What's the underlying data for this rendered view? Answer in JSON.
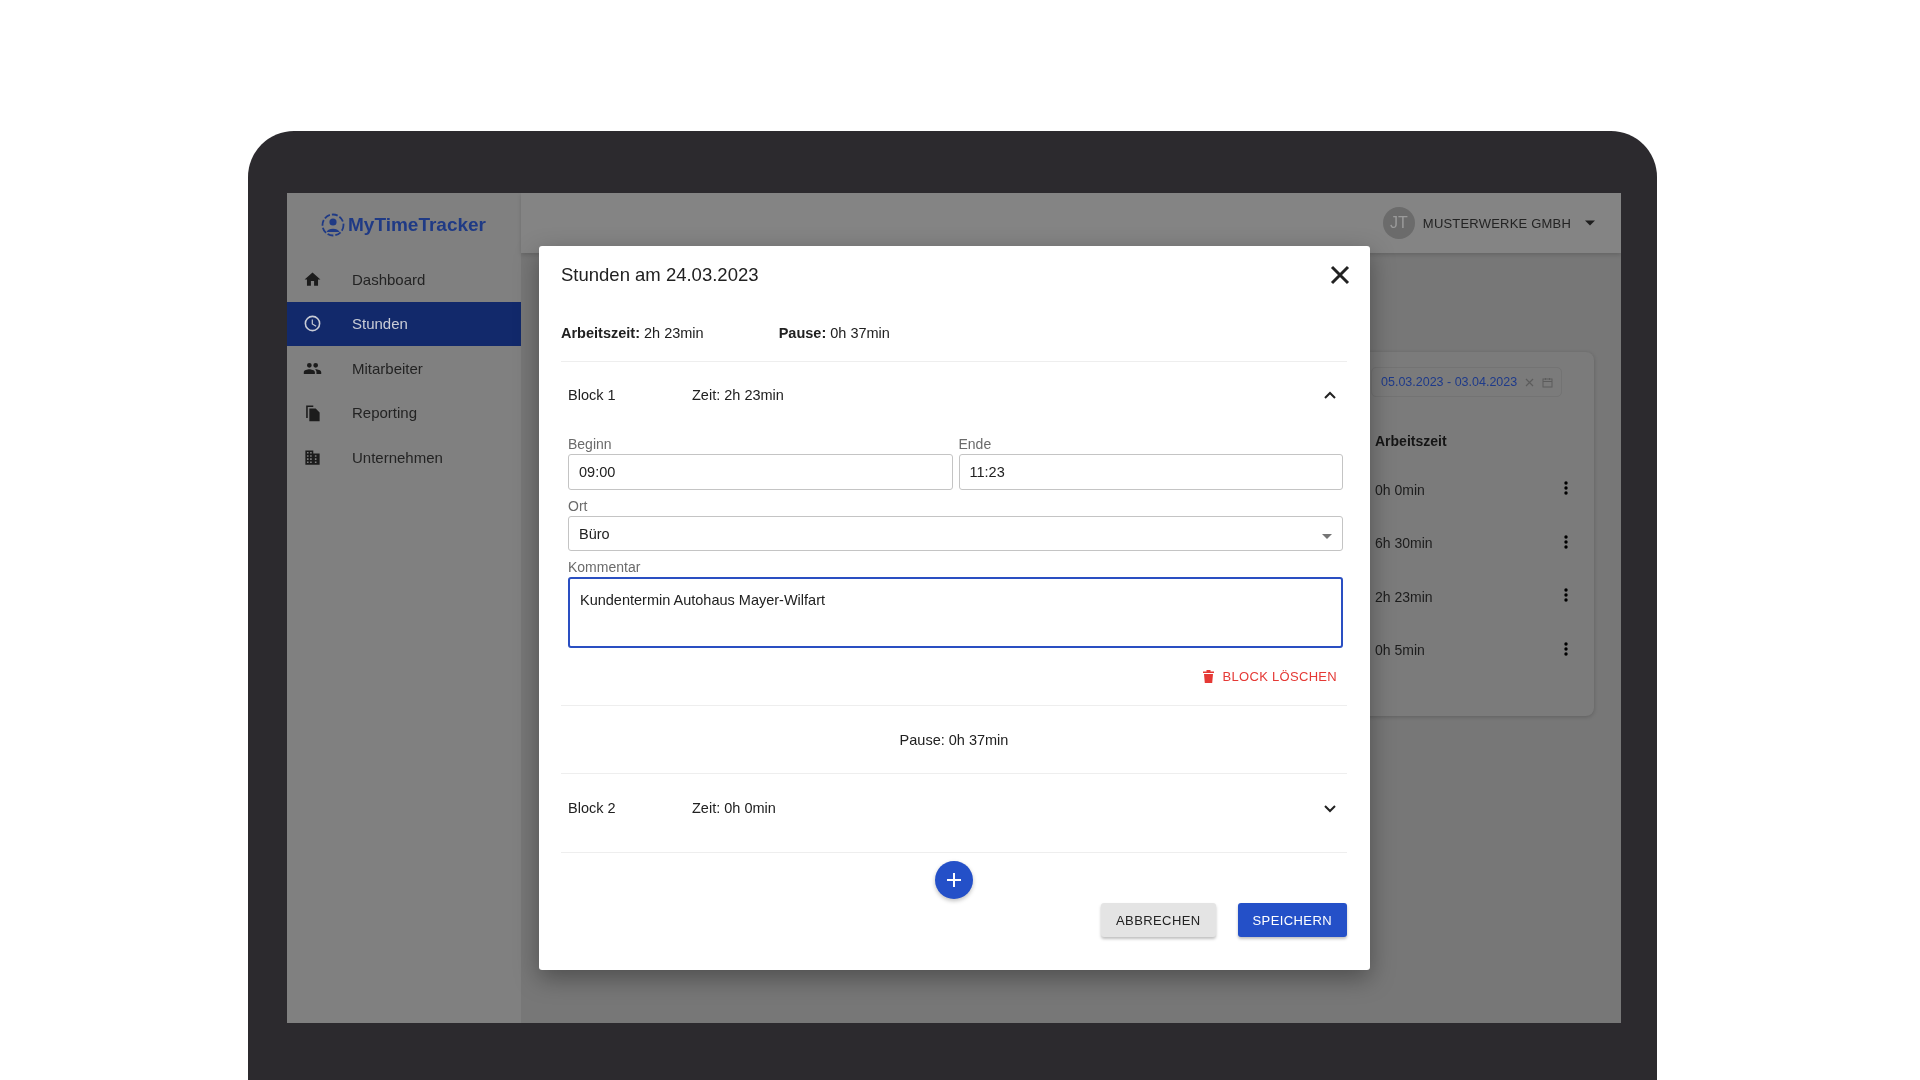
{
  "app": {
    "logo": "MyTimeTracker",
    "nav": [
      {
        "label": "Dashboard",
        "selected": false
      },
      {
        "label": "Stunden",
        "selected": true
      },
      {
        "label": "Mitarbeiter",
        "selected": false
      },
      {
        "label": "Reporting",
        "selected": false
      },
      {
        "label": "Unternehmen",
        "selected": false
      }
    ],
    "account": {
      "initials": "JT",
      "company": "MUSTERWERKE GMBH"
    }
  },
  "background_card": {
    "date_range": "05.03.2023 - 03.04.2023",
    "column": "Arbeitszeit",
    "rows": [
      "0h 0min",
      "6h 30min",
      "2h 23min",
      "0h 5min"
    ]
  },
  "dialog": {
    "title": "Stunden am 24.03.2023",
    "summary": [
      "**Arbeitszeit:** 2h 23min",
      "**Pause:** 0h 37min"
    ],
    "sections": [
      {
        "kind": "block",
        "name": "Block 1",
        "time": "Zeit: 2h 23min",
        "expanded": true,
        "fields": [
          {
            "kind": "text",
            "label": "Beginn",
            "value": "09:00",
            "focused": false
          },
          {
            "kind": "text",
            "label": "Ende",
            "value": "11:23",
            "focused": false
          },
          {
            "kind": "select",
            "label": "Ort",
            "value": "Büro",
            "focused": false
          },
          {
            "kind": "textarea",
            "label": "Kommentar",
            "value": "Kundentermin Autohaus Mayer-Wilfart",
            "focused": true
          }
        ],
        "delete_label": "BLOCK LÖSCHEN"
      },
      {
        "kind": "pause",
        "text": "Pause: 0h 37min"
      },
      {
        "kind": "block",
        "name": "Block 2",
        "time": "Zeit: 0h 0min",
        "expanded": false
      }
    ],
    "buttons": [
      {
        "label": "ABBRECHEN",
        "kind": "secondary"
      },
      {
        "label": "SPEICHERN",
        "kind": "primary"
      }
    ]
  }
}
